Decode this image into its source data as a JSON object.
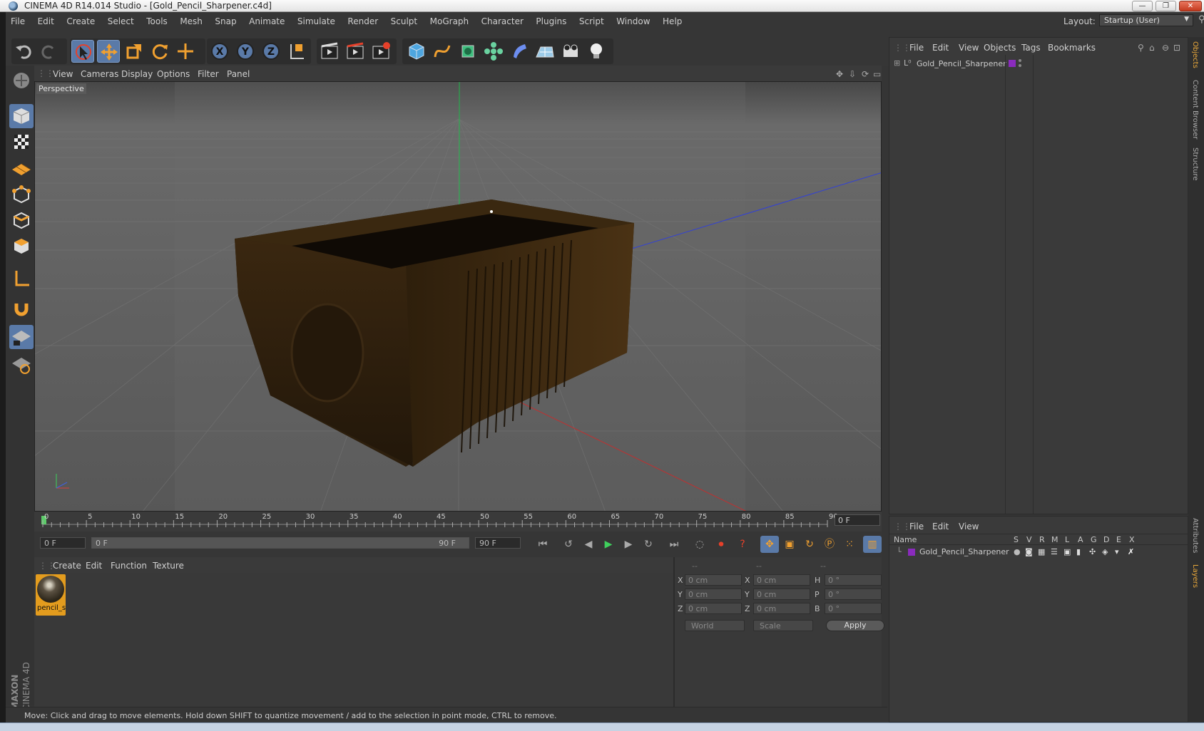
{
  "window": {
    "title": "CINEMA 4D R14.014 Studio - [Gold_Pencil_Sharpener.c4d]",
    "min": "—",
    "restore": "❐",
    "close": "✕"
  },
  "menu": [
    "File",
    "Edit",
    "Create",
    "Select",
    "Tools",
    "Mesh",
    "Snap",
    "Animate",
    "Simulate",
    "Render",
    "Sculpt",
    "MoGraph",
    "Character",
    "Plugins",
    "Script",
    "Window",
    "Help"
  ],
  "layout": {
    "label": "Layout:",
    "value": "Startup (User)"
  },
  "viewport": {
    "menu": [
      "View",
      "Cameras",
      "Display",
      "Options",
      "Filter",
      "Panel"
    ],
    "label": "Perspective"
  },
  "timeline": {
    "ticks": [
      "0",
      "5",
      "10",
      "15",
      "20",
      "25",
      "30",
      "35",
      "40",
      "45",
      "50",
      "55",
      "60",
      "65",
      "70",
      "75",
      "80",
      "85",
      "90"
    ],
    "frame": "0 F"
  },
  "transport": {
    "start": "0 F",
    "range_start": "0 F",
    "range_end": "90 F",
    "end": "90 F"
  },
  "material": {
    "menu": [
      "Create",
      "Edit",
      "Function",
      "Texture"
    ],
    "items": [
      {
        "name": "pencil_s"
      }
    ]
  },
  "coords": {
    "headers": [
      "--",
      "--",
      "--"
    ],
    "rows": [
      {
        "a": "X",
        "av": "0 cm",
        "b": "X",
        "bv": "0 cm",
        "c": "H",
        "cv": "0 °"
      },
      {
        "a": "Y",
        "av": "0 cm",
        "b": "Y",
        "bv": "0 cm",
        "c": "P",
        "cv": "0 °"
      },
      {
        "a": "Z",
        "av": "0 cm",
        "b": "Z",
        "bv": "0 cm",
        "c": "B",
        "cv": "0 °"
      }
    ],
    "world": "World",
    "scale": "Scale",
    "apply": "Apply"
  },
  "status": "Move: Click and drag to move elements. Hold down SHIFT to quantize movement / add to the selection in point mode, CTRL to remove.",
  "objects": {
    "menu": [
      "File",
      "Edit",
      "View",
      "Objects",
      "Tags",
      "Bookmarks"
    ],
    "items": [
      {
        "name": "Gold_Pencil_Sharpener"
      }
    ]
  },
  "layers": {
    "menu": [
      "File",
      "Edit",
      "View"
    ],
    "header_name": "Name",
    "columns": [
      "S",
      "V",
      "R",
      "M",
      "L",
      "A",
      "G",
      "D",
      "E",
      "X"
    ],
    "items": [
      {
        "name": "Gold_Pencil_Sharpener"
      }
    ]
  },
  "side_tabs": [
    "Objects",
    "Content Browser",
    "Structure",
    "Attributes",
    "Layers"
  ],
  "maxon": {
    "line1": "MAXON",
    "line2": "CINEMA 4D"
  },
  "colors": {
    "accent": "#5a7aa8",
    "object_color": "#8a2bbd",
    "toolbar_orange": "#f0a030"
  }
}
